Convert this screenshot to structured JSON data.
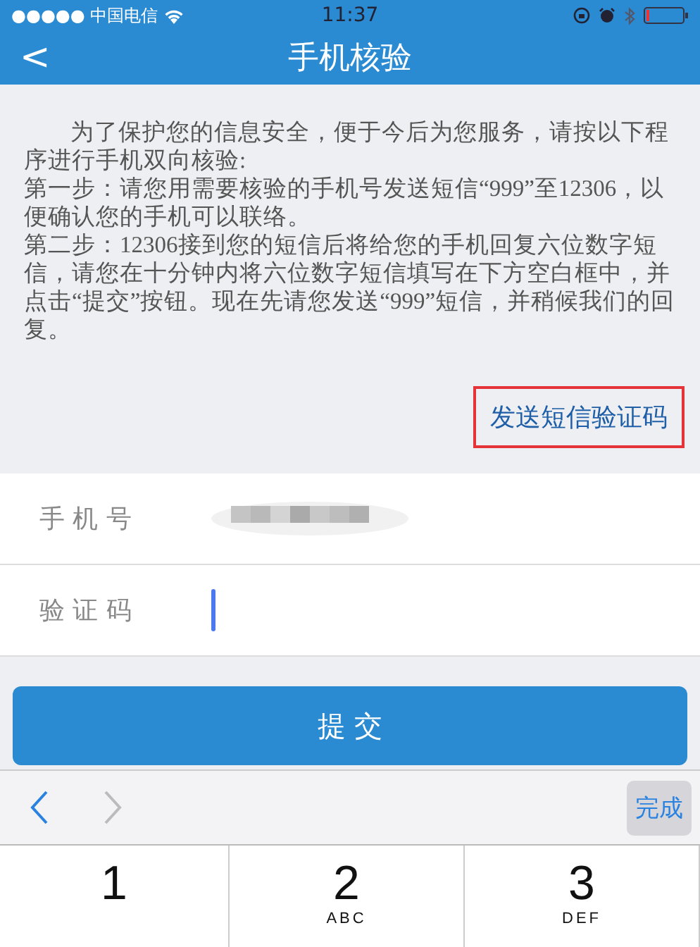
{
  "status_bar": {
    "carrier": "●●●●● 中国电信",
    "time": "11:37"
  },
  "nav": {
    "back": "<",
    "title": "手机核验"
  },
  "instructions": [
    "为了保护您的信息安全，便于今后为您服务，请按以下程序进行手机双向核验:",
    "第一步：请您用需要核验的手机号发送短信“999”至12306，以便确认您的手机可以联络。",
    "第二步：12306接到您的短信后将给您的手机回复六位数字短信，请您在十分钟内将六位数字短信填写在下方空白框中，并点击“提交”按钮。现在先请您发送“999”短信，并稍候我们的回复。"
  ],
  "send_code_link": {
    "label": "发送短信验证码",
    "highlighted": true
  },
  "form": [
    {
      "label": "手 机 号",
      "kind": "redacted"
    },
    {
      "label": "验 证 码",
      "kind": "input",
      "focused": true
    }
  ],
  "submit": "提 交",
  "keyboard_toolbar": {
    "prev_enabled": true,
    "next_enabled": false,
    "done": "完成"
  },
  "keys": [
    {
      "digit": "1"
    },
    {
      "digit": "2",
      "letters": "ABC"
    },
    {
      "digit": "3",
      "letters": "DEF"
    }
  ]
}
